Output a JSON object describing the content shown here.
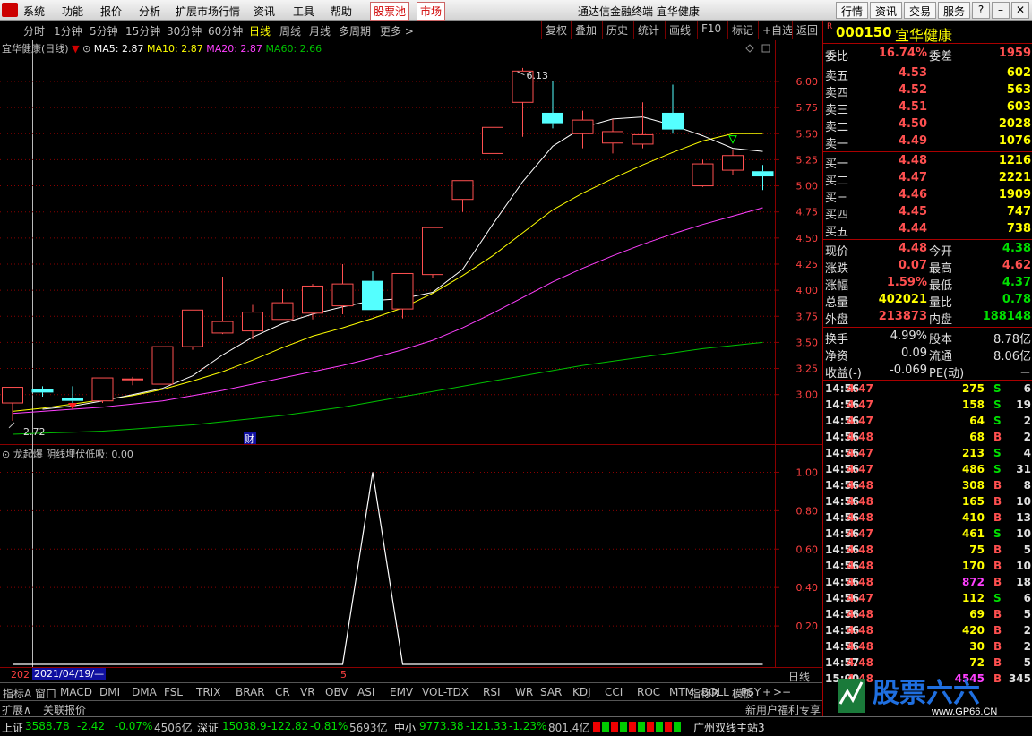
{
  "menu": {
    "items": [
      "系统",
      "功能",
      "报价",
      "分析",
      "扩展市场行情",
      "资讯",
      "工具",
      "帮助"
    ],
    "red_tabs": [
      "股票池",
      "市场"
    ],
    "title": "通达信金融终端  宜华健康",
    "right_buttons": [
      "行情",
      "资讯",
      "交易",
      "服务"
    ]
  },
  "periods": [
    "分时",
    "1分钟",
    "5分钟",
    "15分钟",
    "30分钟",
    "60分钟",
    "日线",
    "周线",
    "月线",
    "多周期",
    "更多 >"
  ],
  "active_period": "日线",
  "toolbar": [
    "复权",
    "叠加",
    "历史",
    "统计",
    "画线",
    "F10",
    "标记",
    "+自选",
    "返回"
  ],
  "main_info": {
    "name": "宜华健康(日线)",
    "ma5": "MA5: 2.87",
    "ma10": "MA10: 2.87",
    "ma20": "MA20: 2.87",
    "ma60": "MA60: 2.66",
    "colors": {
      "ma5": "#ffffff",
      "ma10": "#ffff00",
      "ma20": "#ff40ff",
      "ma60": "#00c000"
    }
  },
  "chart_data": [
    {
      "type": "candlestick",
      "title": "宜华健康(日线)",
      "y_ticks": [
        "6.00",
        "5.75",
        "5.50",
        "5.25",
        "5.00",
        "4.75",
        "4.50",
        "4.25",
        "4.00",
        "3.75",
        "3.50",
        "3.25",
        "3.00"
      ],
      "ylim": [
        2.62,
        6.24
      ],
      "candles": [
        {
          "o": 2.92,
          "c": 3.07,
          "h": 3.07,
          "l": 2.75
        },
        {
          "o": 3.05,
          "c": 3.02,
          "h": 3.08,
          "l": 2.98
        },
        {
          "o": 2.97,
          "c": 2.94,
          "h": 3.08,
          "l": 2.9
        },
        {
          "o": 2.94,
          "c": 3.16,
          "h": 3.16,
          "l": 2.92
        },
        {
          "o": 3.15,
          "c": 3.15,
          "h": 3.17,
          "l": 3.09
        },
        {
          "o": 3.1,
          "c": 3.46,
          "h": 3.46,
          "l": 3.1
        },
        {
          "o": 3.46,
          "c": 3.81,
          "h": 3.81,
          "l": 3.43
        },
        {
          "o": 3.59,
          "c": 3.7,
          "h": 4.13,
          "l": 3.58
        },
        {
          "o": 3.61,
          "c": 3.79,
          "h": 3.86,
          "l": 3.53
        },
        {
          "o": 3.72,
          "c": 3.88,
          "h": 4.01,
          "l": 3.72
        },
        {
          "o": 3.78,
          "c": 4.04,
          "h": 4.06,
          "l": 3.72
        },
        {
          "o": 3.85,
          "c": 4.06,
          "h": 4.25,
          "l": 3.77
        },
        {
          "o": 4.09,
          "c": 3.81,
          "h": 4.18,
          "l": 3.81
        },
        {
          "o": 3.82,
          "c": 4.16,
          "h": 4.16,
          "l": 3.73
        },
        {
          "o": 4.15,
          "c": 4.6,
          "h": 4.6,
          "l": 4.12
        },
        {
          "o": 4.87,
          "c": 5.05,
          "h": 5.05,
          "l": 4.75
        },
        {
          "o": 5.31,
          "c": 5.56,
          "h": 5.56,
          "l": 5.31
        },
        {
          "o": 5.8,
          "c": 6.1,
          "h": 6.13,
          "l": 5.47
        },
        {
          "o": 5.7,
          "c": 5.6,
          "h": 6.0,
          "l": 5.55
        },
        {
          "o": 5.5,
          "c": 5.63,
          "h": 5.72,
          "l": 5.36
        },
        {
          "o": 5.41,
          "c": 5.52,
          "h": 5.64,
          "l": 5.31
        },
        {
          "o": 5.4,
          "c": 5.49,
          "h": 5.8,
          "l": 5.36
        },
        {
          "o": 5.7,
          "c": 5.54,
          "h": 5.97,
          "l": 5.5
        },
        {
          "o": 5.0,
          "c": 5.21,
          "h": 5.25,
          "l": 4.99
        },
        {
          "o": 5.15,
          "c": 5.29,
          "h": 5.35,
          "l": 5.1
        },
        {
          "o": 5.14,
          "c": 5.09,
          "h": 5.2,
          "l": 4.96
        }
      ],
      "ma5": [
        2.86,
        2.89,
        2.94,
        3.0,
        3.06,
        3.18,
        3.38,
        3.55,
        3.68,
        3.77,
        3.84,
        3.9,
        3.92,
        3.98,
        4.2,
        4.63,
        5.04,
        5.38,
        5.56,
        5.64,
        5.66,
        5.58,
        5.48,
        5.36,
        5.33
      ],
      "ma10": [
        2.84,
        2.87,
        2.91,
        2.95,
        2.99,
        3.05,
        3.13,
        3.22,
        3.33,
        3.45,
        3.56,
        3.64,
        3.73,
        3.83,
        3.97,
        4.14,
        4.33,
        4.55,
        4.77,
        4.93,
        5.07,
        5.2,
        5.32,
        5.43,
        5.5,
        5.5
      ],
      "ma20": [
        2.82,
        2.84,
        2.86,
        2.88,
        2.91,
        2.94,
        2.99,
        3.04,
        3.1,
        3.16,
        3.22,
        3.28,
        3.35,
        3.43,
        3.52,
        3.64,
        3.78,
        3.93,
        4.08,
        4.21,
        4.33,
        4.44,
        4.54,
        4.63,
        4.71,
        4.79
      ],
      "ma60": [
        2.62,
        2.63,
        2.64,
        2.65,
        2.67,
        2.69,
        2.71,
        2.74,
        2.77,
        2.8,
        2.84,
        2.88,
        2.93,
        2.98,
        3.03,
        3.08,
        3.13,
        3.18,
        3.23,
        3.28,
        3.32,
        3.36,
        3.4,
        3.44,
        3.47,
        3.5
      ],
      "annotations": [
        "6.13",
        "2.72",
        "财"
      ]
    },
    {
      "type": "line",
      "title": "龙起爆",
      "series_name": "阴线埋伏低吸: 0.00",
      "y_ticks": [
        "1.00",
        "0.80",
        "0.60",
        "0.40",
        "0.20"
      ],
      "ylim": [
        0,
        1.1
      ],
      "values": [
        0,
        0,
        0,
        0,
        0,
        0,
        0,
        0,
        0,
        0,
        0,
        0,
        1,
        0,
        0,
        0,
        0,
        0,
        0,
        0,
        0,
        0,
        0,
        0,
        0,
        0
      ]
    }
  ],
  "sub_info": {
    "title": "龙起爆",
    "value": "阴线埋伏低吸: 0.00"
  },
  "date_bar": {
    "prefix": "202",
    "date": "2021/04/19/—",
    "mark": "5",
    "right_label": "日线"
  },
  "indicators": [
    "指标A",
    "窗口",
    "MACD",
    "DMI",
    "DMA",
    "FSL",
    "TRIX",
    "BRAR",
    "CR",
    "VR",
    "OBV",
    "ASI",
    "EMV",
    "VOL-TDX",
    "RSI",
    "WR",
    "SAR",
    "KDJ",
    "CCI",
    "ROC",
    "MTM",
    "BOLL",
    "PSY",
    ">"
  ],
  "indicator_right": [
    "指标B",
    "模板",
    "+",
    "−"
  ],
  "ext_bar": [
    "扩展∧",
    "关联报价"
  ],
  "ext_right": "新用户福利专享",
  "status": {
    "sh_label": "上证",
    "sh_val": "3588.78",
    "sh_chg": "-2.42",
    "sh_pct": "-0.07%",
    "sh_amt": "4506亿",
    "sz_label": "深证",
    "sz_val": "15038.9",
    "sz_chg": "-122.82",
    "sz_pct": "-0.81%",
    "sz_amt": "5693亿",
    "zx_label": "中小",
    "zx_val": "9773.38",
    "zx_chg": "-121.33",
    "zx_pct": "-1.23%",
    "zx_amt": "801.4亿",
    "server": "广州双线主站3"
  },
  "right_panel": {
    "code": "000150",
    "name": "宜华健康",
    "r_mark": "R",
    "weibi_label": "委比",
    "weibi": "16.74%",
    "weicha_label": "委差",
    "weicha": "1959",
    "asks": [
      {
        "label": "卖五",
        "price": "4.53",
        "vol": "602"
      },
      {
        "label": "卖四",
        "price": "4.52",
        "vol": "563"
      },
      {
        "label": "卖三",
        "price": "4.51",
        "vol": "603"
      },
      {
        "label": "卖二",
        "price": "4.50",
        "vol": "2028"
      },
      {
        "label": "卖一",
        "price": "4.49",
        "vol": "1076"
      }
    ],
    "bids": [
      {
        "label": "买一",
        "price": "4.48",
        "vol": "1216"
      },
      {
        "label": "买二",
        "price": "4.47",
        "vol": "2221"
      },
      {
        "label": "买三",
        "price": "4.46",
        "vol": "1909"
      },
      {
        "label": "买四",
        "price": "4.45",
        "vol": "747"
      },
      {
        "label": "买五",
        "price": "4.44",
        "vol": "738"
      }
    ],
    "quote": [
      {
        "l1": "现价",
        "v1": "4.48",
        "c1": "r",
        "l2": "今开",
        "v2": "4.38",
        "c2": "g"
      },
      {
        "l1": "涨跌",
        "v1": "0.07",
        "c1": "r",
        "l2": "最高",
        "v2": "4.62",
        "c2": "r"
      },
      {
        "l1": "涨幅",
        "v1": "1.59%",
        "c1": "r",
        "l2": "最低",
        "v2": "4.37",
        "c2": "g"
      },
      {
        "l1": "总量",
        "v1": "402021",
        "c1": "y",
        "l2": "量比",
        "v2": "0.78",
        "c2": "g"
      },
      {
        "l1": "外盘",
        "v1": "213873",
        "c1": "r",
        "l2": "内盘",
        "v2": "188148",
        "c2": "g"
      }
    ],
    "fund": [
      {
        "l1": "换手",
        "v1": "4.99%",
        "l2": "股本",
        "v2": "8.78亿"
      },
      {
        "l1": "净资",
        "v1": "0.09",
        "l2": "流通",
        "v2": "8.06亿"
      },
      {
        "l1": "收益(-)",
        "v1": "-0.069",
        "l2": "PE(动)",
        "v2": "－"
      }
    ],
    "ticks": [
      {
        "t": "14:56",
        "p": "4.47",
        "v": "275",
        "s": "S",
        "n": "6"
      },
      {
        "t": "14:56",
        "p": "4.47",
        "v": "158",
        "s": "S",
        "n": "19"
      },
      {
        "t": "14:56",
        "p": "4.47",
        "v": "64",
        "s": "S",
        "n": "2"
      },
      {
        "t": "14:56",
        "p": "4.48",
        "v": "68",
        "s": "B",
        "n": "2"
      },
      {
        "t": "14:56",
        "p": "4.47",
        "v": "213",
        "s": "S",
        "n": "4"
      },
      {
        "t": "14:56",
        "p": "4.47",
        "v": "486",
        "s": "S",
        "n": "31"
      },
      {
        "t": "14:56",
        "p": "4.48",
        "v": "308",
        "s": "B",
        "n": "8"
      },
      {
        "t": "14:56",
        "p": "4.48",
        "v": "165",
        "s": "B",
        "n": "10"
      },
      {
        "t": "14:56",
        "p": "4.48",
        "v": "410",
        "s": "B",
        "n": "13"
      },
      {
        "t": "14:56",
        "p": "4.47",
        "v": "461",
        "s": "S",
        "n": "10"
      },
      {
        "t": "14:56",
        "p": "4.48",
        "v": "75",
        "s": "B",
        "n": "5"
      },
      {
        "t": "14:56",
        "p": "4.48",
        "v": "170",
        "s": "B",
        "n": "10"
      },
      {
        "t": "14:56",
        "p": "4.48",
        "v": "872",
        "s": "B",
        "n": "18"
      },
      {
        "t": "14:56",
        "p": "4.47",
        "v": "112",
        "s": "S",
        "n": "6"
      },
      {
        "t": "14:56",
        "p": "4.48",
        "v": "69",
        "s": "B",
        "n": "5"
      },
      {
        "t": "14:56",
        "p": "4.48",
        "v": "420",
        "s": "B",
        "n": "2"
      },
      {
        "t": "14:56",
        "p": "4.48",
        "v": "30",
        "s": "B",
        "n": "2"
      },
      {
        "t": "14:57",
        "p": "4.48",
        "v": "72",
        "s": "B",
        "n": "5"
      },
      {
        "t": "15:00",
        "p": "4.48",
        "v": "4545",
        "s": "B",
        "n": "345"
      }
    ]
  },
  "watermark": {
    "brand": "股票六六",
    "url": "www.GP66.CN"
  },
  "colors": {
    "up": "#ff5050",
    "down": "#54ffff",
    "ma5": "#ffffff",
    "ma10": "#ffff00",
    "ma20": "#ff40ff",
    "ma60": "#00c000",
    "grid": "#8b0000"
  }
}
